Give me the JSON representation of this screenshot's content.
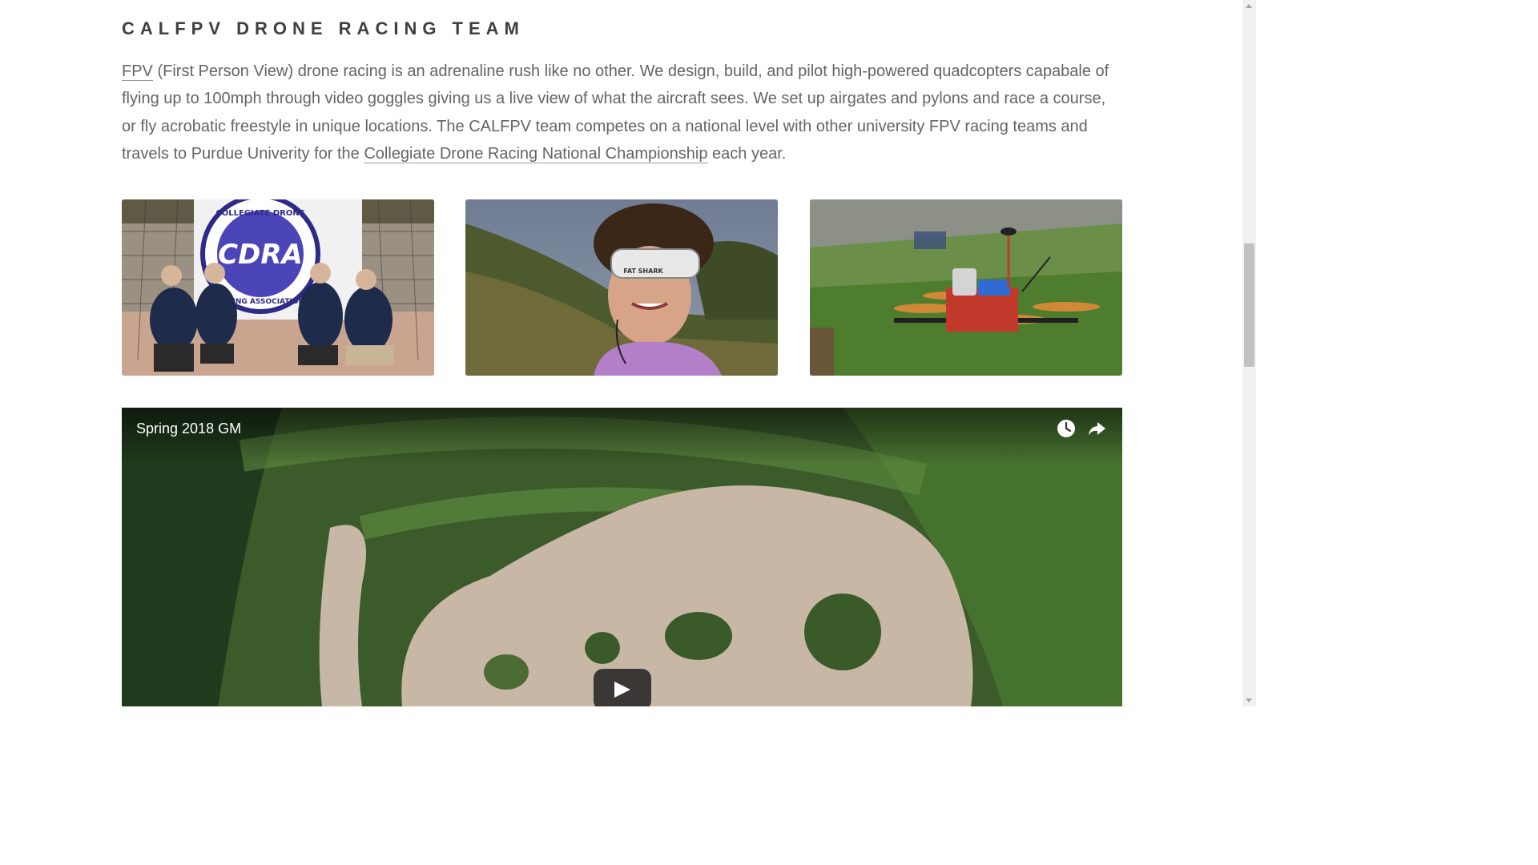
{
  "section": {
    "title": "CALFPV DRONE RACING TEAM",
    "intro": {
      "link_fpv": "FPV",
      "text_1": " (First Person View) drone racing is an adrenaline rush like no other. We design, build, and pilot high-powered quadcopters capabale of flying up to 100mph through video goggles giving us a live view of what the aircraft sees. We set up airgates and pylons and race a course, or fly acrobatic freestyle in unique locations. The CALFPV team competes on a national level with other university FPV racing teams and travels to Purdue Univerity for the ",
      "link_championship": "Collegiate Drone Racing National Championship",
      "text_2": " each year."
    }
  },
  "photos": [
    {
      "name": "team-banner-photo",
      "banner_text_top": "COLLEGIATE DRONE",
      "banner_text_main": "CDRA",
      "banner_text_bottom": "RACING ASSOCIATION"
    },
    {
      "name": "goggles-pilot-photo",
      "goggles_brand": "FAT SHARK"
    },
    {
      "name": "quadcopter-photo"
    }
  ],
  "video": {
    "title": "Spring 2018 GM",
    "watch_later_icon": "clock-icon",
    "share_icon": "share-arrow-icon",
    "play_icon": "play-icon"
  },
  "colors": {
    "title": "#3f3f3f",
    "body_text": "#646464",
    "video_overlay_text": "#ffffff",
    "play_button": "#212121"
  }
}
